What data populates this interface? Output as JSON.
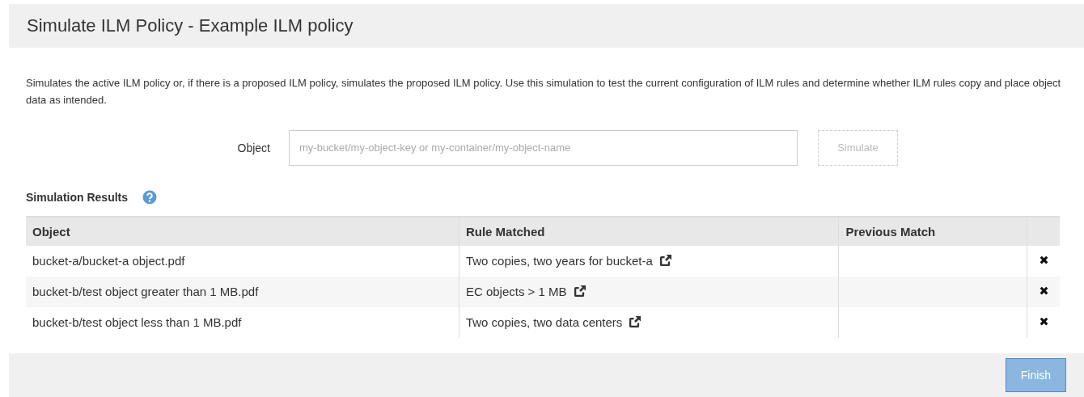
{
  "dialog": {
    "title": "Simulate ILM Policy - Example ILM policy",
    "description": "Simulates the active ILM policy or, if there is a proposed ILM policy, simulates the proposed ILM policy. Use this simulation to test the current configuration of ILM rules and determine whether ILM rules copy and place object data as intended.",
    "object_field": {
      "label": "Object",
      "placeholder": "my-bucket/my-object-key or my-container/my-object-name"
    },
    "simulate_button": {
      "label": "Simulate",
      "disabled": true
    },
    "results": {
      "heading": "Simulation Results",
      "columns": [
        "Object",
        "Rule Matched",
        "Previous Match"
      ],
      "rows": [
        {
          "object": "bucket-a/bucket-a object.pdf",
          "rule": "Two copies, two years for bucket-a"
        },
        {
          "object": "bucket-b/test object greater than 1 MB.pdf",
          "rule": "EC objects > 1 MB"
        },
        {
          "object": "bucket-b/test object less than 1 MB.pdf",
          "rule": "Two copies, two data centers"
        }
      ]
    },
    "finish_button": {
      "label": "Finish",
      "disabled": true
    }
  }
}
